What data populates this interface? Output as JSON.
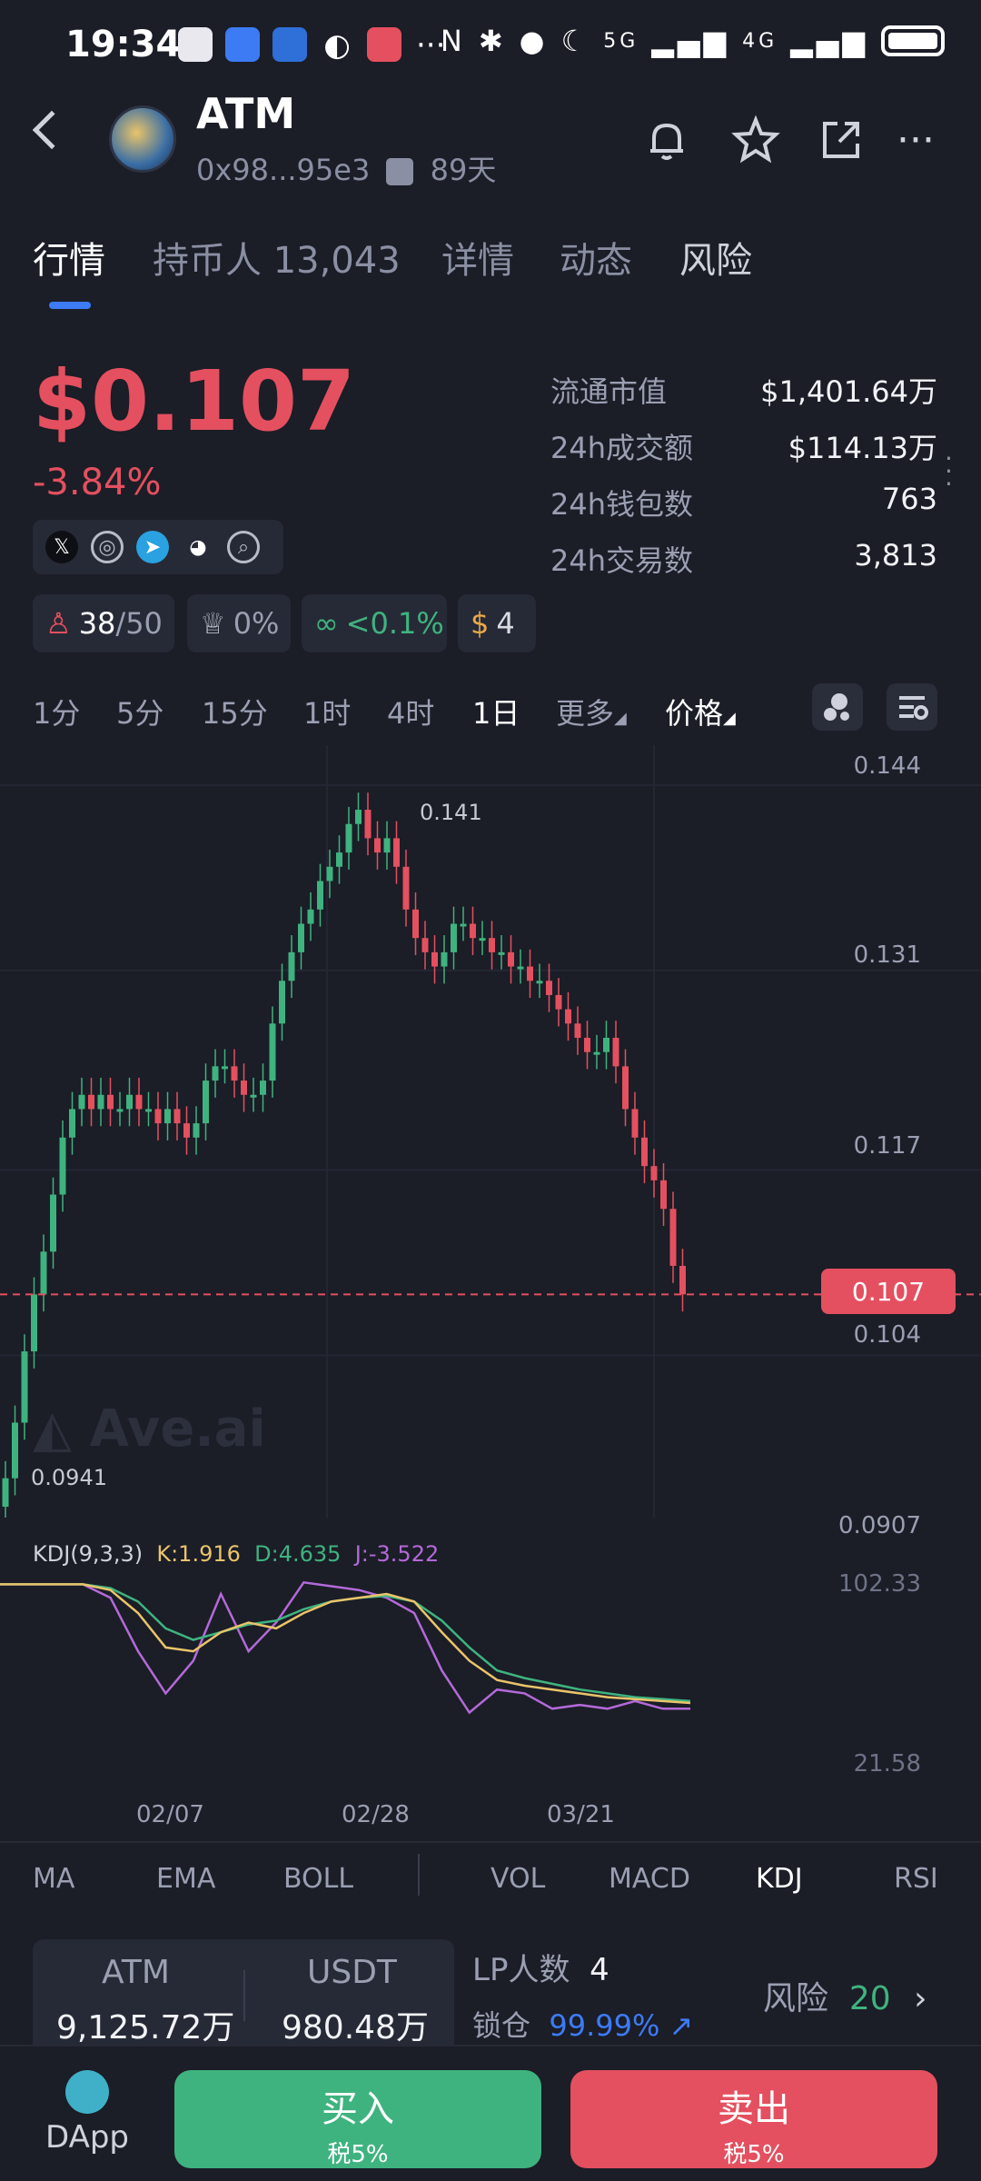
{
  "status_bar": {
    "time": "19:34",
    "network_5g": "5G",
    "network_4g": "4G"
  },
  "header": {
    "title": "ATM",
    "address": "0x98...95e3",
    "age": "89天"
  },
  "tabs": [
    {
      "label": "行情"
    },
    {
      "label": "持币人 13,043"
    },
    {
      "label": "详情"
    },
    {
      "label": "动态"
    },
    {
      "label": "风险"
    }
  ],
  "price": {
    "value": "$0.107",
    "change": "-3.84%"
  },
  "stats": [
    {
      "label": "流通市值",
      "value": "$1,401.64万"
    },
    {
      "label": "24h成交额",
      "value": "$114.13万"
    },
    {
      "label": "24h钱包数",
      "value": "763"
    },
    {
      "label": "24h交易数",
      "value": "3,813"
    }
  ],
  "pills": {
    "score": "38",
    "score_max": "/50",
    "hat": "0%",
    "holding": "<0.1%",
    "bag": "4"
  },
  "timeframes": [
    "1分",
    "5分",
    "15分",
    "1时",
    "4时",
    "1日",
    "更多",
    "价格"
  ],
  "chart": {
    "y_ticks": [
      "0.144",
      "0.131",
      "0.117",
      "0.104",
      "0.0907"
    ],
    "current_price": "0.107",
    "high_label": "0.141",
    "low_label": "0.0941",
    "watermark": "Ave.ai",
    "x_ticks": [
      "02/07",
      "02/28",
      "03/21"
    ],
    "kdj": {
      "name": "KDJ(9,3,3)",
      "k": "K:1.916",
      "d": "D:4.635",
      "j": "J:-3.522",
      "top": "102.33",
      "bottom": "21.58"
    }
  },
  "chart_data": {
    "type": "candlestick",
    "x_ticks": [
      "02/07",
      "02/28",
      "03/21"
    ],
    "ylim": [
      0.0907,
      0.144
    ],
    "close": [
      0.0941,
      0.098,
      0.103,
      0.107,
      0.11,
      0.114,
      0.118,
      0.12,
      0.121,
      0.12,
      0.121,
      0.12,
      0.12,
      0.121,
      0.12,
      0.12,
      0.119,
      0.12,
      0.119,
      0.118,
      0.119,
      0.122,
      0.123,
      0.123,
      0.122,
      0.121,
      0.121,
      0.122,
      0.126,
      0.129,
      0.131,
      0.133,
      0.134,
      0.136,
      0.137,
      0.138,
      0.14,
      0.141,
      0.139,
      0.138,
      0.139,
      0.137,
      0.134,
      0.132,
      0.131,
      0.13,
      0.131,
      0.133,
      0.133,
      0.132,
      0.132,
      0.131,
      0.131,
      0.13,
      0.13,
      0.129,
      0.129,
      0.128,
      0.127,
      0.126,
      0.125,
      0.124,
      0.124,
      0.125,
      0.123,
      0.12,
      0.118,
      0.116,
      0.115,
      0.113,
      0.109,
      0.107
    ],
    "kdj_k": [
      95,
      95,
      95,
      95,
      92,
      80,
      62,
      60,
      70,
      75,
      72,
      80,
      86,
      88,
      90,
      86,
      70,
      55,
      45,
      42,
      40,
      38,
      36,
      35,
      34,
      33
    ],
    "kdj_d": [
      95,
      95,
      95,
      95,
      93,
      86,
      72,
      66,
      70,
      74,
      76,
      82,
      86,
      88,
      89,
      86,
      76,
      62,
      50,
      46,
      43,
      40,
      38,
      36,
      35,
      34
    ],
    "kdj_j": [
      95,
      95,
      95,
      95,
      88,
      60,
      38,
      55,
      90,
      60,
      75,
      96,
      94,
      92,
      88,
      80,
      50,
      28,
      40,
      38,
      30,
      32,
      30,
      34,
      30,
      30
    ],
    "kdj_range": [
      21.58,
      102.33
    ]
  },
  "indicators": [
    "MA",
    "EMA",
    "BOLL",
    "VOL",
    "MACD",
    "KDJ",
    "RSI"
  ],
  "lp": {
    "token_a": "ATM",
    "amount_a": "9,125.72万",
    "token_b": "USDT",
    "amount_b": "980.48万",
    "lp_count_label": "LP人数",
    "lp_count": "4",
    "lock_label": "锁仓",
    "lock_value": "99.99%",
    "risk_label": "风险",
    "risk_value": "20"
  },
  "bottom": {
    "dapp": "DApp",
    "buy": "买入",
    "buy_tax": "税5%",
    "sell": "卖出",
    "sell_tax": "税5%"
  },
  "colors": {
    "up": "#3fb37f",
    "down": "#e4505f",
    "accent": "#3d7bf5"
  }
}
